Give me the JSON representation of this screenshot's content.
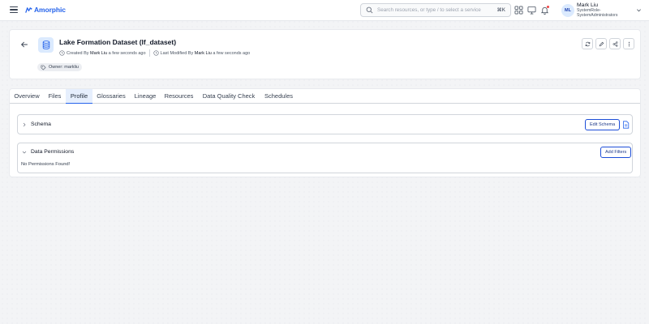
{
  "topbar": {
    "brand": "Amorphic",
    "search_placeholder": "Search resources, or type / to select a service",
    "search_shortcut": "⌘K",
    "user_initials": "ML",
    "user_name": "Mark Liu",
    "user_role_line1": "SystemRole-",
    "user_role_line2": "SystemAdministrators"
  },
  "header": {
    "title": "Lake Formation Dataset (lf_dataset)",
    "created_prefix": "Created By",
    "created_by": "Mark Liu",
    "created_when": "a few seconds ago",
    "modified_prefix": "Last Modified By",
    "modified_by": "Mark Liu",
    "modified_when": "a few seconds ago",
    "owner_label": "Owner: markliu"
  },
  "tabs": [
    {
      "label": "Overview"
    },
    {
      "label": "Files"
    },
    {
      "label": "Profile",
      "active": true
    },
    {
      "label": "Glossaries"
    },
    {
      "label": "Lineage"
    },
    {
      "label": "Resources"
    },
    {
      "label": "Data Quality Check"
    },
    {
      "label": "Schedules"
    }
  ],
  "schema_panel": {
    "title": "Schema",
    "edit_button": "Edit Schema"
  },
  "permissions_panel": {
    "title": "Data Permissions",
    "add_button": "Add Filters",
    "empty_message": "No Permissions Found!"
  },
  "colors": {
    "accent": "#2563eb",
    "active_tab_bg": "#e6effd",
    "notification": "#ef4444"
  },
  "icons": [
    "hamburger-icon",
    "logo-icon",
    "search-icon",
    "grid-icon",
    "monitor-icon",
    "bell-icon",
    "chevron-down-icon",
    "back-arrow-icon",
    "database-icon",
    "user-clock-icon",
    "edit-clock-icon",
    "owner-tag-icon",
    "refresh-icon",
    "edit-icon",
    "share-icon",
    "more-icon",
    "chevron-right-icon",
    "document-icon"
  ]
}
